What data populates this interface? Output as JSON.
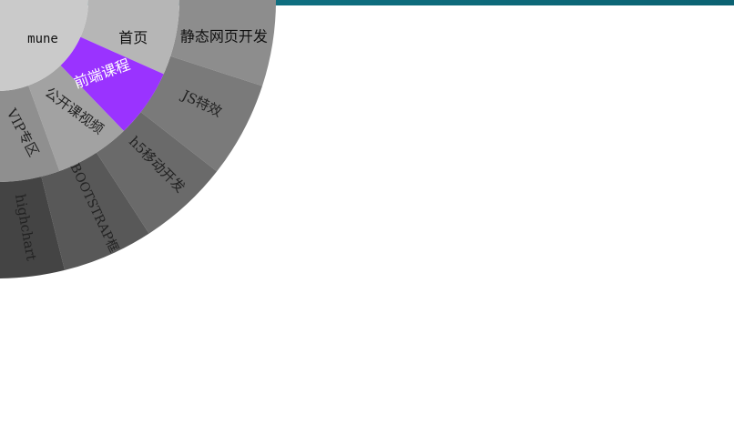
{
  "center": {
    "label": "mune"
  },
  "inner_ring": [
    {
      "label": "首页",
      "active": false
    },
    {
      "label": "前端课程",
      "active": true
    },
    {
      "label": "公开课视频",
      "active": false
    },
    {
      "label": "VIP专区",
      "active": false
    }
  ],
  "outer_ring": [
    {
      "label": "静态网页开发"
    },
    {
      "label": "JS特效"
    },
    {
      "label": "h5移动开发"
    },
    {
      "label": "BOOTSTRAP框"
    },
    {
      "label": "highchart"
    }
  ],
  "colors": {
    "accent_active": "#9a33ff",
    "top_bar": "#0f6f80"
  }
}
